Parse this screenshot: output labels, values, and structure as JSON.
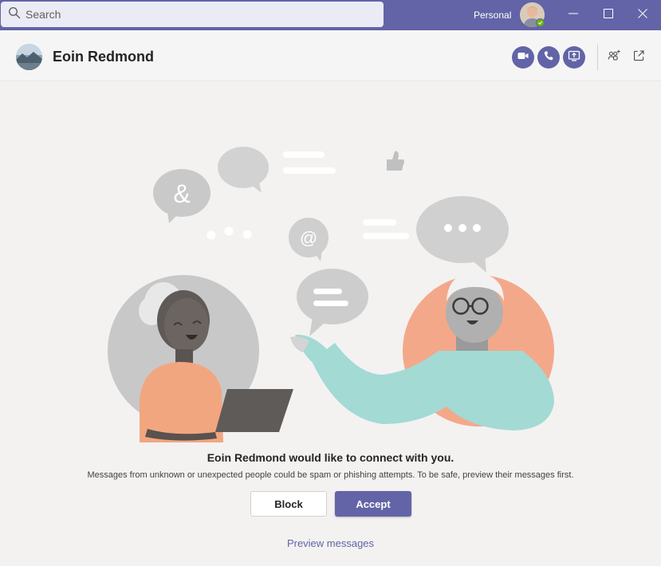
{
  "search": {
    "placeholder": "Search"
  },
  "account": {
    "label": "Personal",
    "presence_color": "#6bb700"
  },
  "window_controls": {
    "icons": [
      "minimize-icon",
      "maximize-icon",
      "close-icon"
    ]
  },
  "header": {
    "contact_name": "Eoin Redmond",
    "actions": [
      "video-call-icon",
      "audio-call-icon",
      "share-screen-icon",
      "add-people-icon",
      "pop-out-icon"
    ]
  },
  "request": {
    "headline": "Eoin Redmond would like to connect with you.",
    "warning": "Messages from unknown or unexpected people could be spam or phishing attempts. To be safe, preview their messages first.",
    "block_label": "Block",
    "accept_label": "Accept",
    "preview_label": "Preview messages"
  },
  "illustration": {
    "bubble_symbols": [
      "&",
      "@"
    ]
  },
  "colors": {
    "brand": "#6264a7",
    "background": "#f3f2f1",
    "header_bg": "#f5f5f5",
    "text": "#242424"
  }
}
